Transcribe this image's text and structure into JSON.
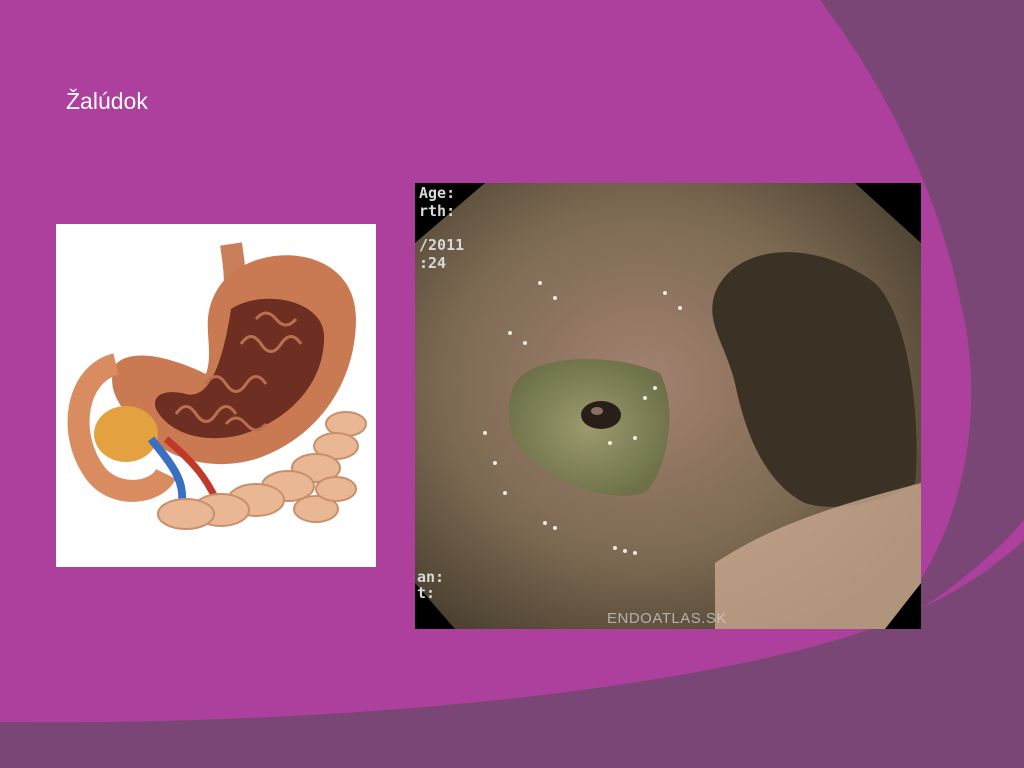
{
  "slide": {
    "title": "Žalúdok",
    "colors": {
      "background": "#ad3f9d",
      "band": "#7a4675",
      "title": "#ffffff"
    }
  },
  "anatomy_image": {
    "icon": "stomach-anatomy-illustration"
  },
  "endoscopy_image": {
    "osd_line1": "Age:",
    "osd_line2": "rth:",
    "osd_line3": "/2011",
    "osd_line4": ":24",
    "osd_line5": "an:",
    "osd_line6": "t:",
    "watermark": "ENDOATLAS.SK"
  }
}
